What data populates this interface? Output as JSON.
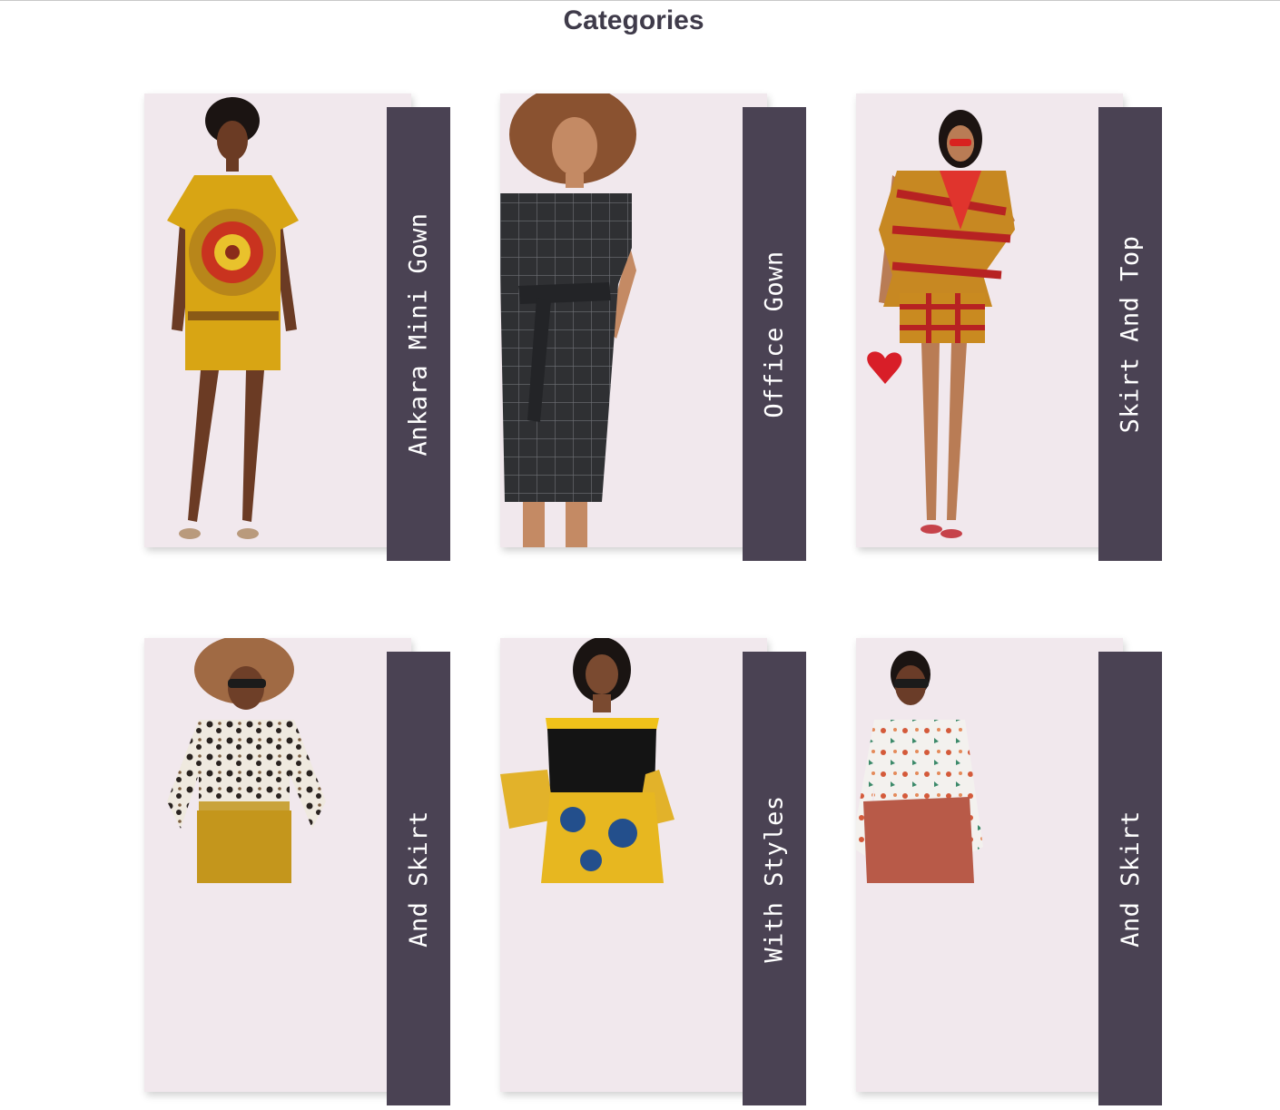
{
  "page": {
    "title": "Categories"
  },
  "colors": {
    "label_panel": "#4a4253",
    "photo_bg": "#f1e8ed",
    "title_text": "#3f3b4a"
  },
  "categories": [
    {
      "label": "Ankara Mini Gown",
      "icon": "ankara-dress-photo"
    },
    {
      "label": "Office Gown",
      "icon": "plaid-office-dress-photo"
    },
    {
      "label": "Skirt And Top",
      "icon": "skirt-and-top-photo"
    },
    {
      "label": "And Skirt",
      "icon": "leopard-blouse-skirt-photo"
    },
    {
      "label": "With Styles",
      "icon": "ankara-styles-dress-photo"
    },
    {
      "label": "And Skirt",
      "icon": "floral-blouse-skirt-photo"
    }
  ]
}
